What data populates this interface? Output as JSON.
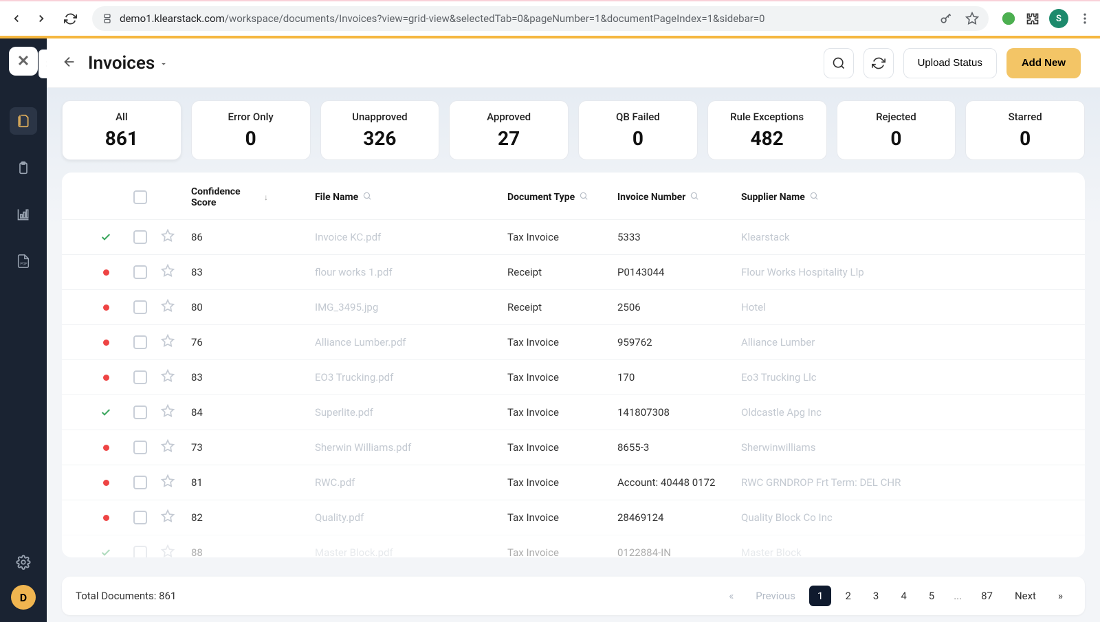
{
  "browser": {
    "url_host": "demo1.klearstack.com",
    "url_path": "/workspace/documents/Invoices?view=grid-view&selectedTab=0&pageNumber=1&documentPageIndex=1&sidebar=0"
  },
  "header": {
    "title": "Invoices",
    "upload_status": "Upload Status",
    "add_new": "Add New"
  },
  "stats": [
    {
      "label": "All",
      "value": "861"
    },
    {
      "label": "Error Only",
      "value": "0"
    },
    {
      "label": "Unapproved",
      "value": "326"
    },
    {
      "label": "Approved",
      "value": "27"
    },
    {
      "label": "QB Failed",
      "value": "0"
    },
    {
      "label": "Rule Exceptions",
      "value": "482"
    },
    {
      "label": "Rejected",
      "value": "0"
    },
    {
      "label": "Starred",
      "value": "0"
    }
  ],
  "columns": {
    "confidence": "Confidence Score",
    "file_name": "File Name",
    "document_type": "Document Type",
    "invoice_number": "Invoice Number",
    "supplier_name": "Supplier Name"
  },
  "rows": [
    {
      "status": "check",
      "confidence": "86",
      "file": "Invoice KC.pdf",
      "doc_type": "Tax Invoice",
      "invoice": "5333",
      "supplier": "Klearstack"
    },
    {
      "status": "red",
      "confidence": "83",
      "file": "flour works 1.pdf",
      "doc_type": "Receipt",
      "invoice": "P0143044",
      "supplier": "Flour Works Hospitality Llp"
    },
    {
      "status": "red",
      "confidence": "80",
      "file": "IMG_3495.jpg",
      "doc_type": "Receipt",
      "invoice": "2506",
      "supplier": "Hotel"
    },
    {
      "status": "red",
      "confidence": "76",
      "file": "Alliance Lumber.pdf",
      "doc_type": "Tax Invoice",
      "invoice": "959762",
      "supplier": "Alliance Lumber"
    },
    {
      "status": "red",
      "confidence": "83",
      "file": "EO3 Trucking.pdf",
      "doc_type": "Tax Invoice",
      "invoice": "170",
      "supplier": "Eo3 Trucking Llc"
    },
    {
      "status": "check",
      "confidence": "84",
      "file": "Superlite.pdf",
      "doc_type": "Tax Invoice",
      "invoice": "141807308",
      "supplier": "Oldcastle Apg Inc"
    },
    {
      "status": "red",
      "confidence": "73",
      "file": "Sherwin Williams.pdf",
      "doc_type": "Tax Invoice",
      "invoice": "8655-3",
      "supplier": "Sherwinwilliams"
    },
    {
      "status": "red",
      "confidence": "81",
      "file": "RWC.pdf",
      "doc_type": "Tax Invoice",
      "invoice": "Account: 40448 0172",
      "supplier": "RWC GRNDROP Frt Term: DEL CHR"
    },
    {
      "status": "red",
      "confidence": "82",
      "file": "Quality.pdf",
      "doc_type": "Tax Invoice",
      "invoice": "28469124",
      "supplier": "Quality Block Co Inc"
    },
    {
      "status": "check",
      "confidence": "88",
      "file": "Master Block.pdf",
      "doc_type": "Tax Invoice",
      "invoice": "0122884-IN",
      "supplier": "Master Block"
    }
  ],
  "footer": {
    "total_label": "Total Documents: 861",
    "prev": "Previous",
    "next": "Next",
    "pages": [
      "1",
      "2",
      "3",
      "4",
      "5"
    ],
    "ellipsis": "...",
    "last_page": "87"
  },
  "avatar_letter": "D",
  "ext_avatar_letter": "S"
}
